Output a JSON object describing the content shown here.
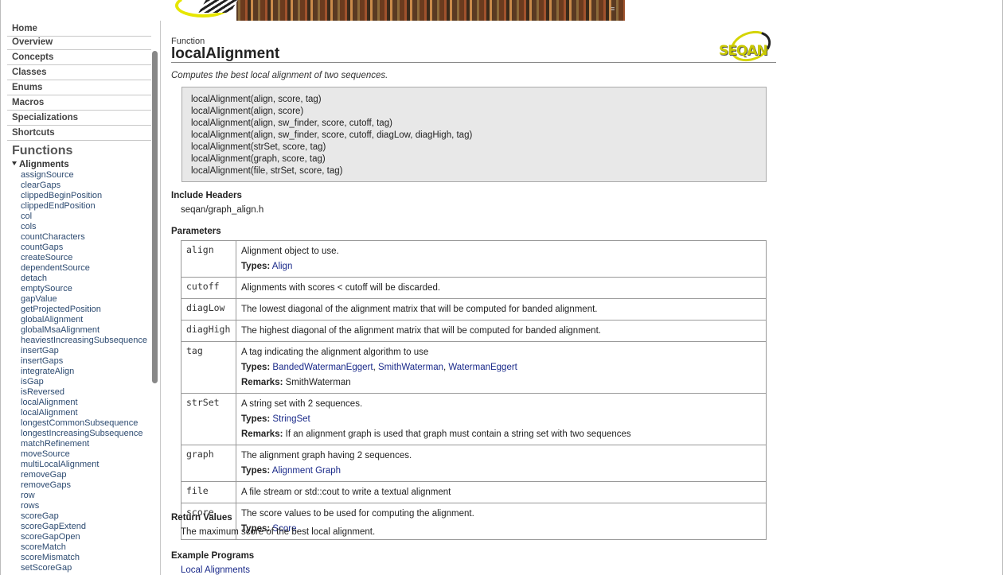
{
  "sidebar": {
    "nav": [
      "Home",
      "Overview",
      "Concepts",
      "Classes",
      "Enums",
      "Macros",
      "Specializations",
      "Shortcuts"
    ],
    "section_title": "Functions",
    "group": "Alignments",
    "functions": [
      "assignSource",
      "clearGaps",
      "clippedBeginPosition",
      "clippedEndPosition",
      "col",
      "cols",
      "countCharacters",
      "countGaps",
      "createSource",
      "dependentSource",
      "detach",
      "emptySource",
      "gapValue",
      "getProjectedPosition",
      "globalAlignment",
      "globalMsaAlignment",
      "heaviestIncreasingSubsequence",
      "insertGap",
      "insertGaps",
      "integrateAlign",
      "isGap",
      "isReversed",
      "localAlignment",
      "localAlignment",
      "longestCommonSubsequence",
      "longestIncreasingSubsequence",
      "matchRefinement",
      "moveSource",
      "multiLocalAlignment",
      "removeGap",
      "removeGaps",
      "row",
      "rows",
      "scoreGap",
      "scoreGapExtend",
      "scoreGapOpen",
      "scoreMatch",
      "scoreMismatch",
      "setScoreGap"
    ]
  },
  "page": {
    "kind": "Function",
    "title": "localAlignment",
    "logo_text": "SEQAN",
    "summary": "Computes the best local alignment of two sequences.",
    "signatures": [
      "localAlignment(align, score, tag)",
      "localAlignment(align, score)",
      "localAlignment(align, sw_finder, score, cutoff, tag)",
      "localAlignment(align, sw_finder, score, cutoff, diagLow, diagHigh, tag)",
      "localAlignment(strSet, score, tag)",
      "localAlignment(graph, score, tag)",
      "localAlignment(file, strSet, score, tag)"
    ],
    "include_heading": "Include Headers",
    "include_value": "seqan/graph_align.h",
    "params_heading": "Parameters",
    "types_label": "Types:",
    "remarks_label": "Remarks:",
    "params": [
      {
        "name": "align",
        "desc": "Alignment object to use.",
        "types": [
          "Align"
        ]
      },
      {
        "name": "cutoff",
        "desc": "Alignments with scores < cutoff will be discarded."
      },
      {
        "name": "diagLow",
        "desc": "The lowest diagonal of the alignment matrix that will be computed for banded alignment."
      },
      {
        "name": "diagHigh",
        "desc": "The highest diagonal of the alignment matrix that will be computed for banded alignment."
      },
      {
        "name": "tag",
        "desc": "A tag indicating the alignment algorithm to use",
        "types": [
          "BandedWatermanEggert",
          "SmithWaterman",
          "WatermanEggert"
        ],
        "remarks": "SmithWaterman"
      },
      {
        "name": "strSet",
        "desc": "A string set with 2 sequences.",
        "types": [
          "StringSet"
        ],
        "remarks": "If an alignment graph is used that graph must contain a string set with two sequences"
      },
      {
        "name": "graph",
        "desc": "The alignment graph having 2 sequences.",
        "types": [
          "Alignment Graph"
        ]
      },
      {
        "name": "file",
        "desc": "A file stream or std::cout to write a textual alignment"
      },
      {
        "name": "score",
        "desc": "The score values to be used for computing the alignment.",
        "types": [
          "Score"
        ]
      }
    ],
    "return_heading": "Return Values",
    "return_value": "The maximum score of the best local alignment.",
    "examples_heading": "Example Programs",
    "example_link": "Local Alignments"
  }
}
